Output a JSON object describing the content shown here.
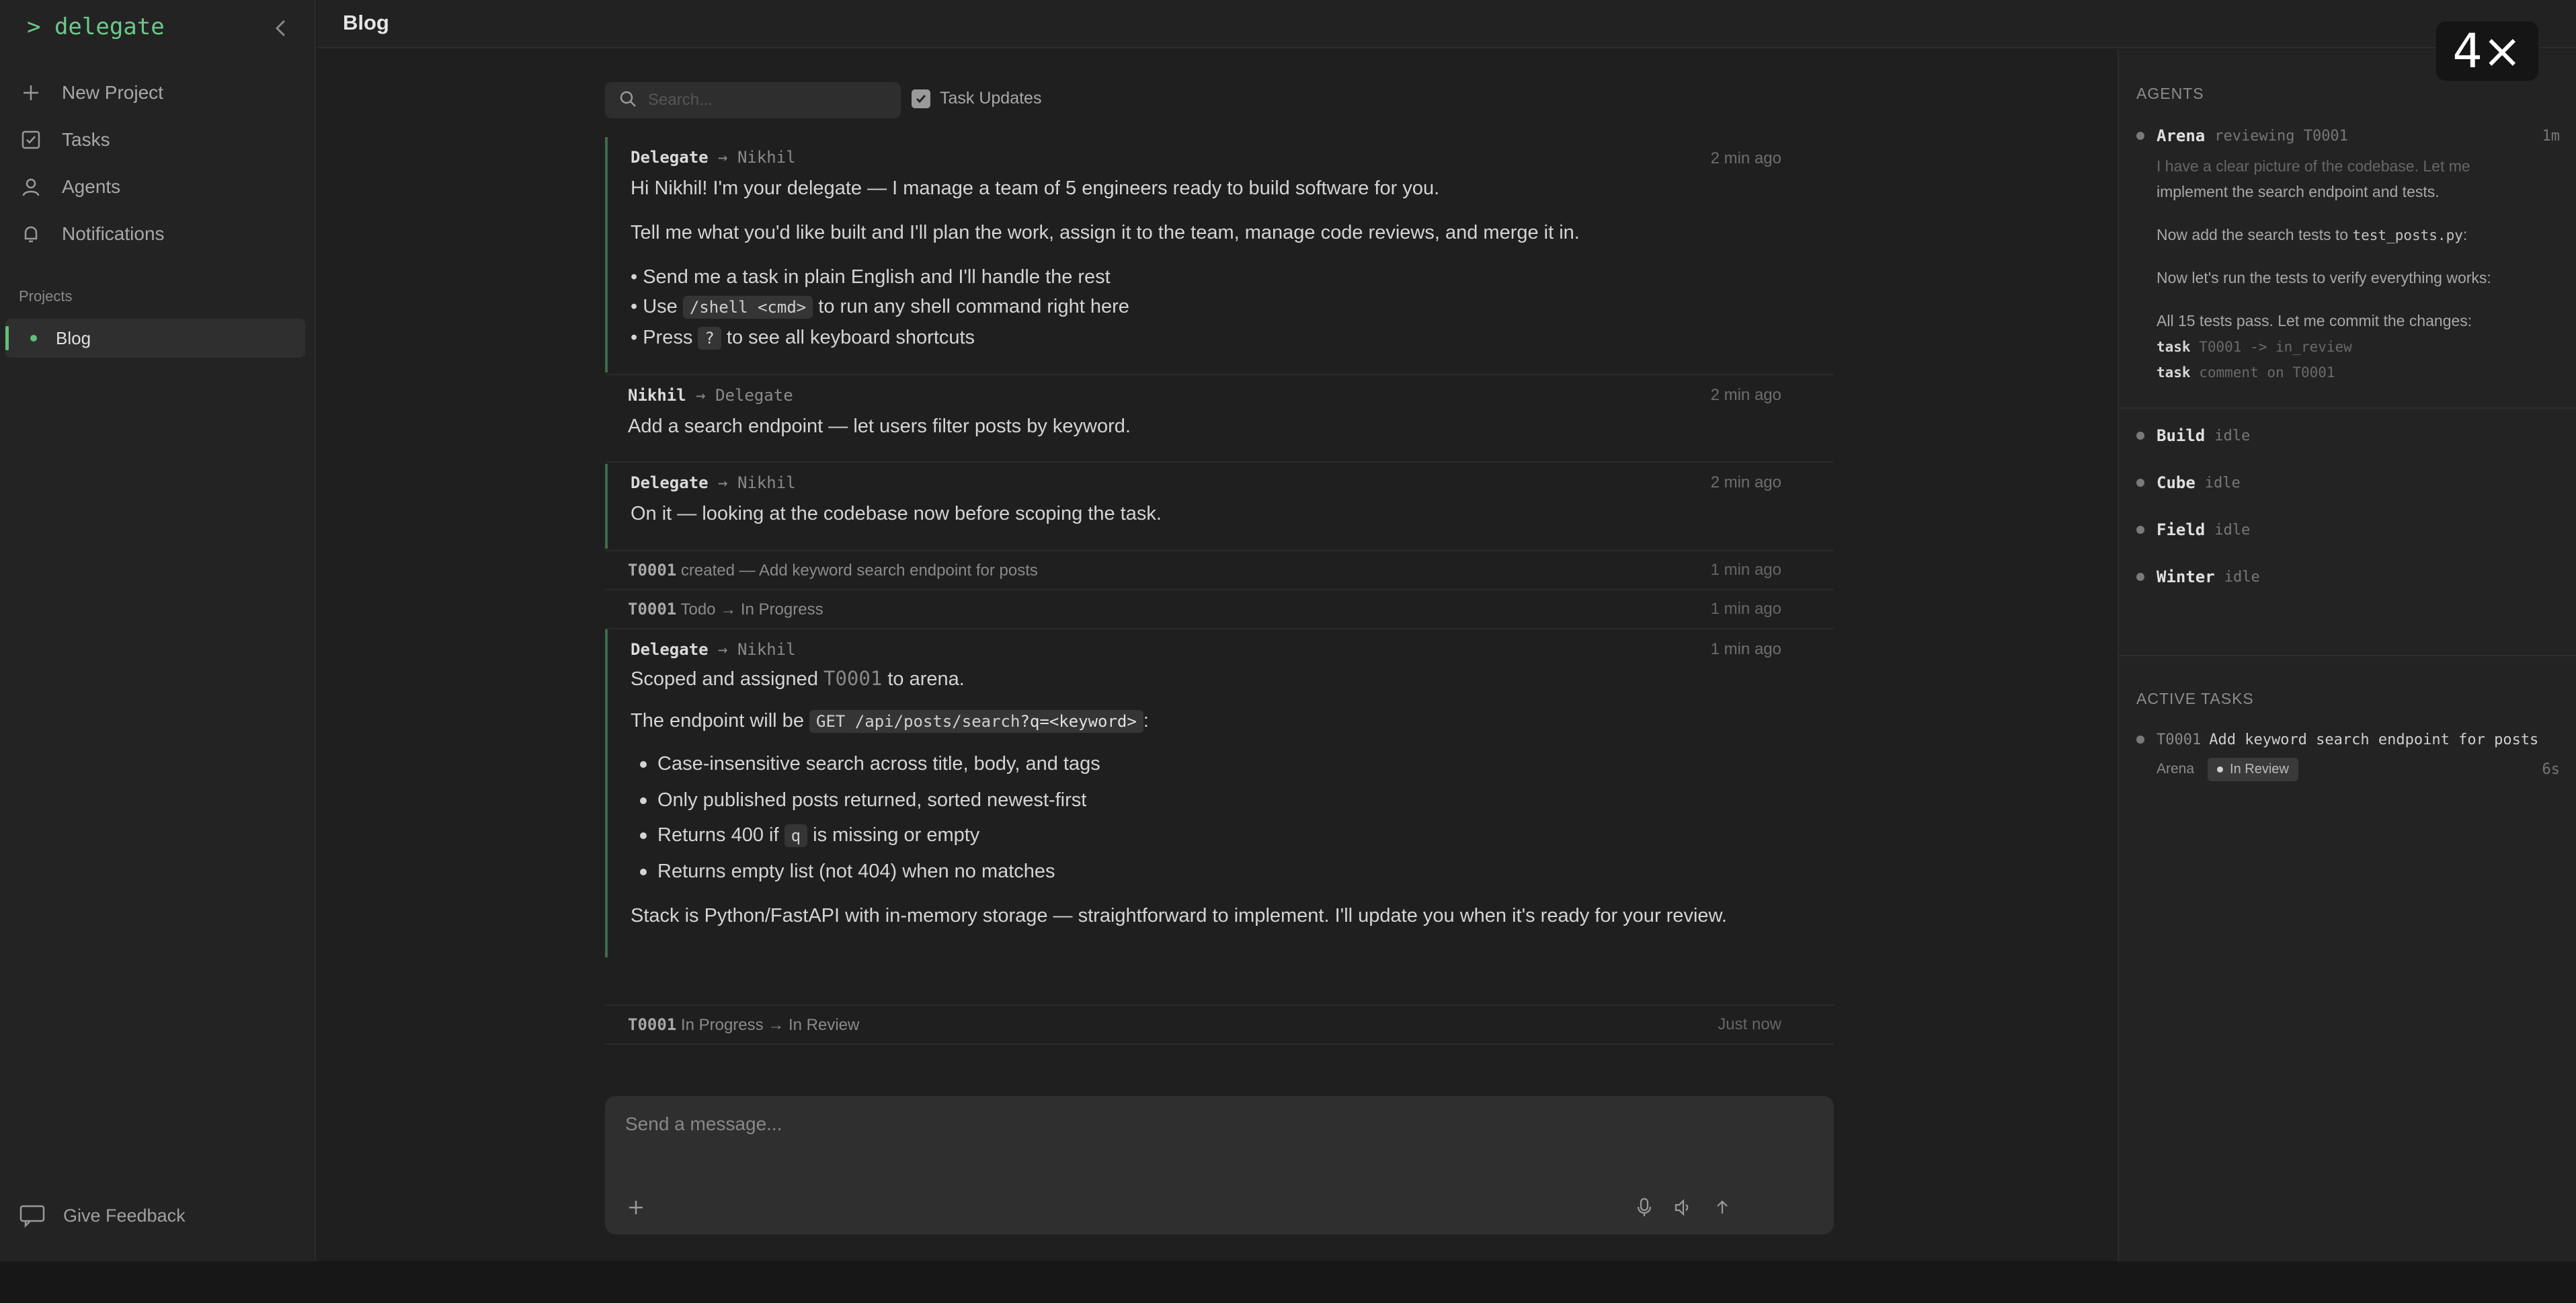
{
  "app": {
    "brand": "> delegate",
    "zoom_label": "4×"
  },
  "sidebar": {
    "nav": [
      {
        "label": "New Project",
        "icon": "plus-icon"
      },
      {
        "label": "Tasks",
        "icon": "checkbox-icon"
      },
      {
        "label": "Agents",
        "icon": "user-icon"
      },
      {
        "label": "Notifications",
        "icon": "bell-icon"
      }
    ],
    "projects_label": "Projects",
    "projects": [
      {
        "label": "Blog",
        "active": true
      }
    ],
    "feedback_label": "Give Feedback"
  },
  "header": {
    "title": "Blog"
  },
  "feed": {
    "search_placeholder": "Search...",
    "task_updates_label": "Task Updates",
    "task_updates_checked": true,
    "messages": {
      "m1": {
        "from": "Delegate",
        "arrow": "→",
        "to": "Nikhil",
        "time": "2 min ago",
        "p1": "Hi Nikhil! I'm your delegate — I manage a team of 5 engineers ready to build software for you.",
        "p2": "Tell me what you'd like built and I'll plan the work, assign it to the team, manage code reviews, and merge it in.",
        "b1": "• Send me a task in plain English and I'll handle the rest",
        "b2_pre": "• Use ",
        "b2_code": "/shell <cmd>",
        "b2_post": " to run any shell command right here",
        "b3_pre": "• Press ",
        "b3_code": "?",
        "b3_post": " to see all keyboard shortcuts"
      },
      "m2": {
        "from": "Nikhil",
        "arrow": "→",
        "to": "Delegate",
        "time": "2 min ago",
        "p1": "Add a search endpoint — let users filter posts by keyword."
      },
      "m3": {
        "from": "Delegate",
        "arrow": "→",
        "to": "Nikhil",
        "time": "2 min ago",
        "p1": "On it — looking at the codebase now before scoping the task."
      },
      "m4": {
        "from": "Delegate",
        "arrow": "→",
        "to": "Nikhil",
        "time": "1 min ago",
        "p1_pre": "Scoped and assigned ",
        "p1_task": "T0001",
        "p1_post": " to arena.",
        "p2_pre": "The endpoint will be ",
        "p2_code_a": "GET /api/posts/search",
        "p2_code_b": "?q=<keyword>",
        "p2_post": ":",
        "b1": "Case-insensitive search across title, body, and tags",
        "b2": "Only published posts returned, sorted newest-first",
        "b3_pre": "Returns 400 if ",
        "b3_code": "q",
        "b3_post": " is missing or empty",
        "b4": "Returns empty list (not 404) when no matches",
        "p3": "Stack is Python/FastAPI with in-memory storage — straightforward to implement. I'll update you when it's ready for your review."
      }
    },
    "events": {
      "e1": {
        "task": "T0001",
        "text": " created — Add keyword search endpoint for posts",
        "time": "1 min ago"
      },
      "e2": {
        "task": "T0001",
        "text": " Todo → In Progress",
        "time": "1 min ago"
      },
      "e3": {
        "task": "T0001",
        "text": " In Progress → In Review",
        "time": "Just now"
      }
    },
    "composer_placeholder": "Send a message..."
  },
  "right_panel": {
    "agents_label": "AGENTS",
    "agents": {
      "arena": {
        "name": "Arena",
        "status": "reviewing T0001",
        "duration": "1m"
      },
      "build": {
        "name": "Build",
        "status": "idle"
      },
      "cube": {
        "name": "Cube",
        "status": "idle"
      },
      "field": {
        "name": "Field",
        "status": "idle"
      },
      "winter": {
        "name": "Winter",
        "status": "idle"
      }
    },
    "arena_log": {
      "l1": "I have a clear picture of the codebase. Let me",
      "l2": "implement the search endpoint and tests.",
      "l3_pre": "Now add the search tests to ",
      "l3_code": "test_posts.py",
      "l3_post": ":",
      "l4": "Now let's run the tests to verify everything works:",
      "l5": "All 15 tests pass. Let me commit the changes:",
      "l6_kw": "task",
      "l6_rest": " T0001 -> in_review",
      "l7_kw": "task",
      "l7_rest": " comment on T0001"
    },
    "active_tasks_label": "ACTIVE TASKS",
    "active_tasks": [
      {
        "id": "T0001",
        "title": "Add keyword search endpoint for posts",
        "assignee": "Arena",
        "status": "In Review",
        "age": "6s"
      }
    ]
  },
  "colors": {
    "accent": "#5fbf7a",
    "background": "#1f1f1f",
    "panel": "#232323"
  }
}
